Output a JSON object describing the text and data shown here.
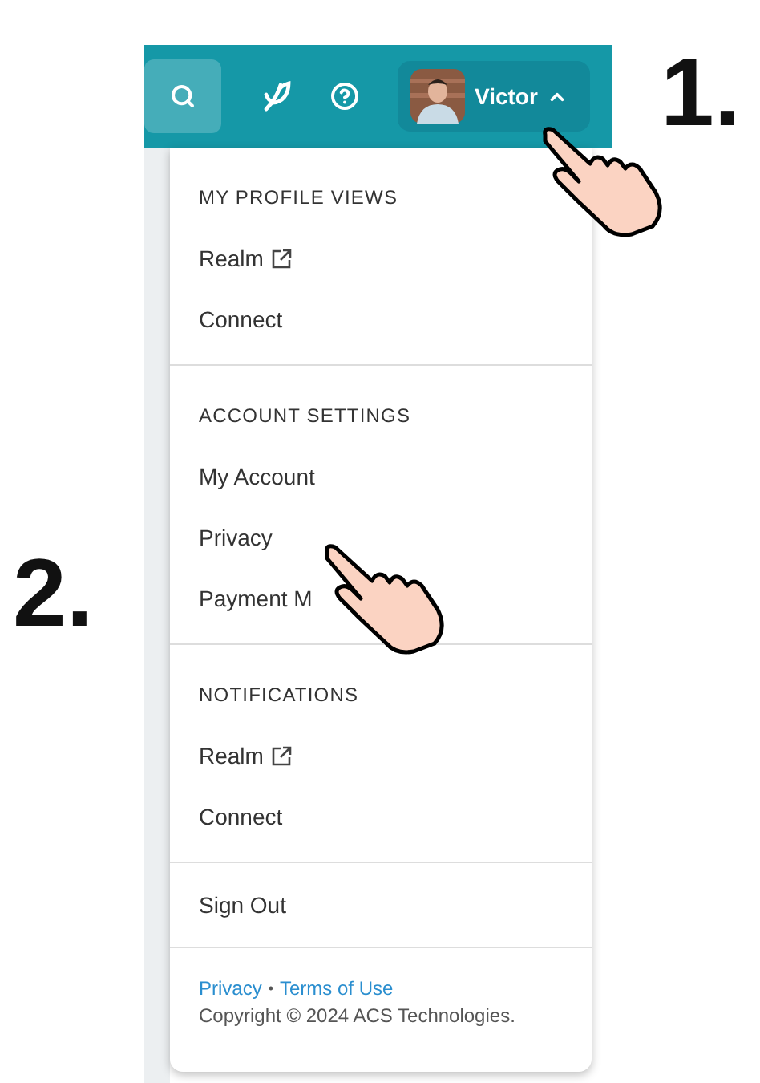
{
  "header": {
    "user_name": "Victor",
    "menu_open": true
  },
  "menu": {
    "sections": [
      {
        "title": "MY PROFILE VIEWS",
        "items": [
          {
            "label": "Realm",
            "external": true
          },
          {
            "label": "Connect",
            "external": false
          }
        ]
      },
      {
        "title": "ACCOUNT SETTINGS",
        "items": [
          {
            "label": "My Account",
            "external": false
          },
          {
            "label": "Privacy",
            "external": false
          },
          {
            "label": "Payment M",
            "external": false
          }
        ]
      },
      {
        "title": "NOTIFICATIONS",
        "items": [
          {
            "label": "Realm",
            "external": true
          },
          {
            "label": "Connect",
            "external": false
          }
        ]
      }
    ],
    "sign_out": "Sign Out"
  },
  "footer": {
    "links": [
      "Privacy",
      "Terms of Use"
    ],
    "separator": "•",
    "copyright": "Copyright © 2024 ACS Technologies."
  },
  "annotations": [
    {
      "label": "1."
    },
    {
      "label": "2."
    }
  ]
}
